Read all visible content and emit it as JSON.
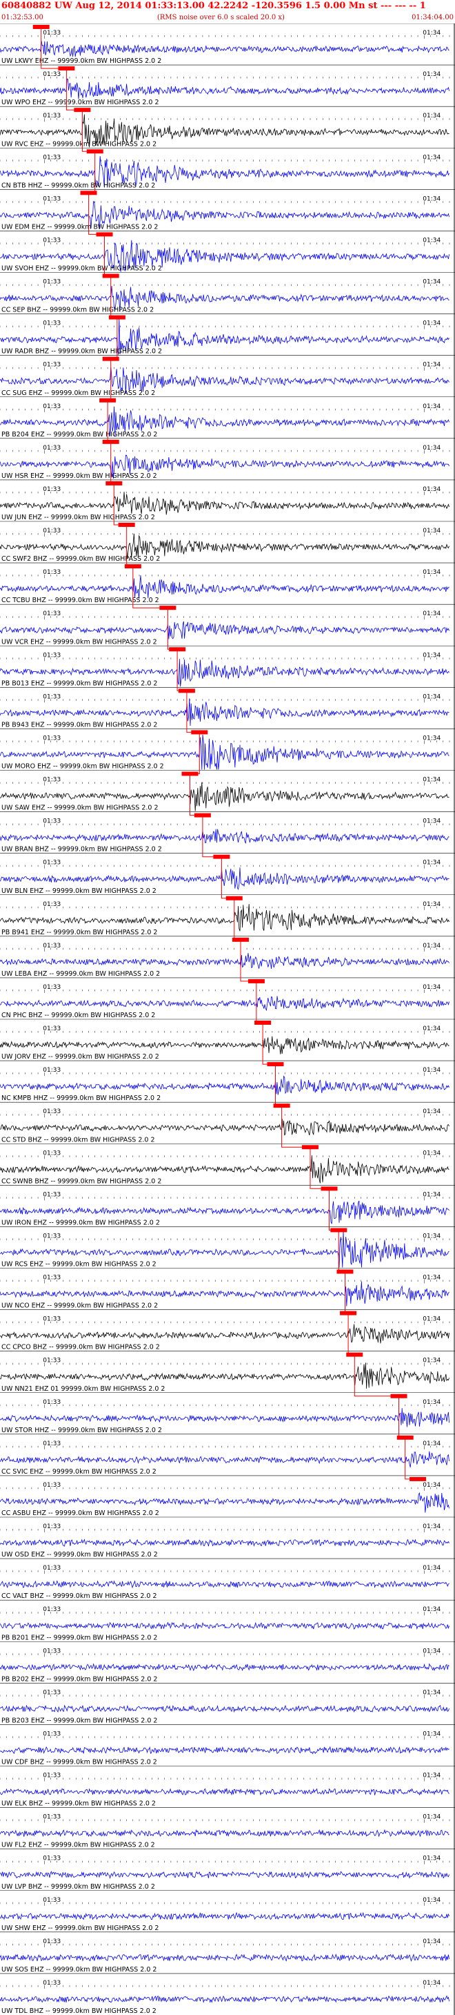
{
  "header": {
    "title": "60840882 UW Aug 12, 2014 01:33:13.00    42.2242  -120.3596   1.5 0.00 Mn st --- --- --  1",
    "title_right": "1",
    "start_time": "01:32:53.00",
    "rms_note": "(RMS noise over 6.0 s scaled 20.0 x)",
    "end_time": "01:34:04.00"
  },
  "colors": {
    "trace": "#0000ff",
    "trace_dark": "#000000",
    "pick": "#ff0000",
    "label": "#000000",
    "header": "#ff0000"
  },
  "chart_data": {
    "type": "line",
    "title": "60840882 UW Aug 12, 2014 01:33:13.00    42.2242  -120.3596   1.5 0.00 Mn st --- --- --  1",
    "x_range": [
      "01:32:53.00",
      "01:34:04.00"
    ],
    "tick_labels": [
      "01:33",
      "01:34"
    ],
    "series": [
      {
        "name": "UW LKWY EHZ -- 99999.0km BW  HIGHPASS  2.0  2",
        "pick_time_s": 6.5,
        "amplitude": 0.35,
        "dark": false
      },
      {
        "name": "UW WPO EHZ -- 99999.0km BW  HIGHPASS  2.0  2",
        "pick_time_s": 10.5,
        "amplitude": 0.4,
        "dark": false
      },
      {
        "name": "UW RVC EHZ -- 99999.0km BW  HIGHPASS  2.0  2",
        "pick_time_s": 13.0,
        "amplitude": 0.8,
        "dark": true
      },
      {
        "name": "CN BTB HHZ -- 99999.0km BW  HIGHPASS  2.0  2",
        "pick_time_s": 15.0,
        "amplitude": 1.0,
        "dark": false
      },
      {
        "name": "UW EDM EHZ -- 99999.0km BW  HIGHPASS  2.0  2",
        "pick_time_s": 14.0,
        "amplitude": 0.6,
        "dark": false
      },
      {
        "name": "UW SVOH EHZ -- 99999.0km BW  HIGHPASS  2.0  2",
        "pick_time_s": 16.5,
        "amplitude": 0.9,
        "dark": false
      },
      {
        "name": "CC SEP BHZ -- 99999.0km BW  HIGHPASS  2.0  2",
        "pick_time_s": 17.5,
        "amplitude": 0.5,
        "dark": false
      },
      {
        "name": "UW RADR BHZ -- 99999.0km BW  HIGHPASS  2.0  2",
        "pick_time_s": 18.5,
        "amplitude": 0.8,
        "dark": false
      },
      {
        "name": "CC SUG EHZ -- 99999.0km BW  HIGHPASS  2.0  2",
        "pick_time_s": 17.5,
        "amplitude": 0.6,
        "dark": false
      },
      {
        "name": "PB B204 EHZ -- 99999.0km BW  HIGHPASS  2.0  2",
        "pick_time_s": 17.0,
        "amplitude": 0.6,
        "dark": false
      },
      {
        "name": "UW HSR EHZ -- 99999.0km BW  HIGHPASS  2.0  2",
        "pick_time_s": 17.5,
        "amplitude": 0.5,
        "dark": false
      },
      {
        "name": "UW JUN EHZ -- 99999.0km BW  HIGHPASS  2.0  2",
        "pick_time_s": 18.0,
        "amplitude": 0.6,
        "dark": true
      },
      {
        "name": "CC SWF2 BHZ -- 99999.0km BW  HIGHPASS  2.0  2",
        "pick_time_s": 20.0,
        "amplitude": 0.5,
        "dark": true
      },
      {
        "name": "CC TCBU BHZ -- 99999.0km BW  HIGHPASS  2.0  2",
        "pick_time_s": 21.0,
        "amplitude": 0.5,
        "dark": false
      },
      {
        "name": "UW VCR EHZ -- 99999.0km BW  HIGHPASS  2.0  2",
        "pick_time_s": 26.5,
        "amplitude": 0.4,
        "dark": false
      },
      {
        "name": "PB B013 EHZ -- 99999.0km BW  HIGHPASS  2.0  2",
        "pick_time_s": 28.0,
        "amplitude": 0.6,
        "dark": false
      },
      {
        "name": "PB B943 EHZ -- 99999.0km BW  HIGHPASS  2.0  2",
        "pick_time_s": 29.5,
        "amplitude": 0.5,
        "dark": false
      },
      {
        "name": "UW MORO EHZ -- 99999.0km BW  HIGHPASS  2.0  2",
        "pick_time_s": 31.5,
        "amplitude": 0.9,
        "dark": false
      },
      {
        "name": "UW SAW EHZ -- 99999.0km BW  HIGHPASS  2.0  2",
        "pick_time_s": 30.0,
        "amplitude": 0.7,
        "dark": true
      },
      {
        "name": "UW BRAN BHZ -- 99999.0km BW  HIGHPASS  2.0  2",
        "pick_time_s": 32.0,
        "amplitude": 0.3,
        "dark": false
      },
      {
        "name": "UW BLN EHZ -- 99999.0km BW  HIGHPASS  2.0  2",
        "pick_time_s": 35.0,
        "amplitude": 0.5,
        "dark": false
      },
      {
        "name": "PB B941 EHZ -- 99999.0km BW  HIGHPASS  2.0  2",
        "pick_time_s": 37.0,
        "amplitude": 0.8,
        "dark": true
      },
      {
        "name": "UW LEBA EHZ -- 99999.0km BW  HIGHPASS  2.0  2",
        "pick_time_s": 38.0,
        "amplitude": 0.3,
        "dark": false
      },
      {
        "name": "CN PHC BHZ -- 99999.0km BW  HIGHPASS  2.0  2",
        "pick_time_s": 40.5,
        "amplitude": 0.3,
        "dark": false
      },
      {
        "name": "UW JORV EHZ -- 99999.0km BW  HIGHPASS  2.0  2",
        "pick_time_s": 41.5,
        "amplitude": 0.4,
        "dark": true
      },
      {
        "name": "NC KMPB HHZ -- 99999.0km BW  HIGHPASS  2.0  2",
        "pick_time_s": 43.5,
        "amplitude": 0.4,
        "dark": false
      },
      {
        "name": "CC STD BHZ -- 99999.0km BW  HIGHPASS  2.0  2",
        "pick_time_s": 44.5,
        "amplitude": 0.4,
        "dark": true
      },
      {
        "name": "CC SWNB BHZ -- 99999.0km BW  HIGHPASS  2.0  2",
        "pick_time_s": 49.0,
        "amplitude": 0.5,
        "dark": true
      },
      {
        "name": "UW IRON EHZ -- 99999.0km BW  HIGHPASS  2.0  2",
        "pick_time_s": 52.0,
        "amplitude": 0.6,
        "dark": false
      },
      {
        "name": "UW RCS EHZ -- 99999.0km BW  HIGHPASS  2.0  2",
        "pick_time_s": 53.5,
        "amplitude": 0.8,
        "dark": false
      },
      {
        "name": "UW NCO EHZ -- 99999.0km BW  HIGHPASS  2.0  2",
        "pick_time_s": 54.5,
        "amplitude": 0.5,
        "dark": false
      },
      {
        "name": "CC CPCO BHZ -- 99999.0km BW  HIGHPASS  2.0  2",
        "pick_time_s": 55.0,
        "amplitude": 0.4,
        "dark": true
      },
      {
        "name": "UW NN21 EHZ 01 99999.0km BW  HIGHPASS  2.0  2",
        "pick_time_s": 56.0,
        "amplitude": 0.7,
        "dark": true
      },
      {
        "name": "UW STOR HHZ -- 99999.0km BW  HIGHPASS  2.0  2",
        "pick_time_s": 63.0,
        "amplitude": 0.4,
        "dark": false
      },
      {
        "name": "CC SVIC EHZ -- 99999.0km BW  HIGHPASS  2.0  2",
        "pick_time_s": 64.0,
        "amplitude": 0.4,
        "dark": false
      },
      {
        "name": "CC ASBU EHZ -- 99999.0km BW  HIGHPASS  2.0  2",
        "pick_time_s": 66.0,
        "amplitude": 0.4,
        "dark": false
      },
      {
        "name": "UW OSD EHZ -- 99999.0km BW  HIGHPASS  2.0  2",
        "pick_time_s": null,
        "amplitude": 0.35,
        "dark": false
      },
      {
        "name": "CC VALT BHZ -- 99999.0km BW  HIGHPASS  2.0  2",
        "pick_time_s": null,
        "amplitude": 0.35,
        "dark": false
      },
      {
        "name": "PB B201 EHZ -- 99999.0km BW  HIGHPASS  2.0  2",
        "pick_time_s": null,
        "amplitude": 0.4,
        "dark": false
      },
      {
        "name": "PB B202 EHZ -- 99999.0km BW  HIGHPASS  2.0  2",
        "pick_time_s": null,
        "amplitude": 0.35,
        "dark": false
      },
      {
        "name": "PB B203 EHZ -- 99999.0km BW  HIGHPASS  2.0  2",
        "pick_time_s": null,
        "amplitude": 0.35,
        "dark": false
      },
      {
        "name": "UW CDF BHZ -- 99999.0km BW  HIGHPASS  2.0  2",
        "pick_time_s": null,
        "amplitude": 0.35,
        "dark": false
      },
      {
        "name": "UW ELK BHZ -- 99999.0km BW  HIGHPASS  2.0  2",
        "pick_time_s": null,
        "amplitude": 0.35,
        "dark": false
      },
      {
        "name": "UW FL2 EHZ -- 99999.0km BW  HIGHPASS  2.0  2",
        "pick_time_s": null,
        "amplitude": 0.35,
        "dark": false
      },
      {
        "name": "UW LVP BHZ -- 99999.0km BW  HIGHPASS  2.0  2",
        "pick_time_s": null,
        "amplitude": 0.35,
        "dark": false
      },
      {
        "name": "UW SHW EHZ -- 99999.0km BW  HIGHPASS  2.0  2",
        "pick_time_s": null,
        "amplitude": 0.35,
        "dark": false
      },
      {
        "name": "UW SOS EHZ -- 99999.0km BW  HIGHPASS  2.0  2",
        "pick_time_s": null,
        "amplitude": 0.35,
        "dark": false
      },
      {
        "name": "UW TDL BHZ -- 99999.0km BW  HIGHPASS  2.0  2",
        "pick_time_s": null,
        "amplitude": 0.35,
        "dark": false
      }
    ],
    "legend": "none",
    "grid": false
  }
}
